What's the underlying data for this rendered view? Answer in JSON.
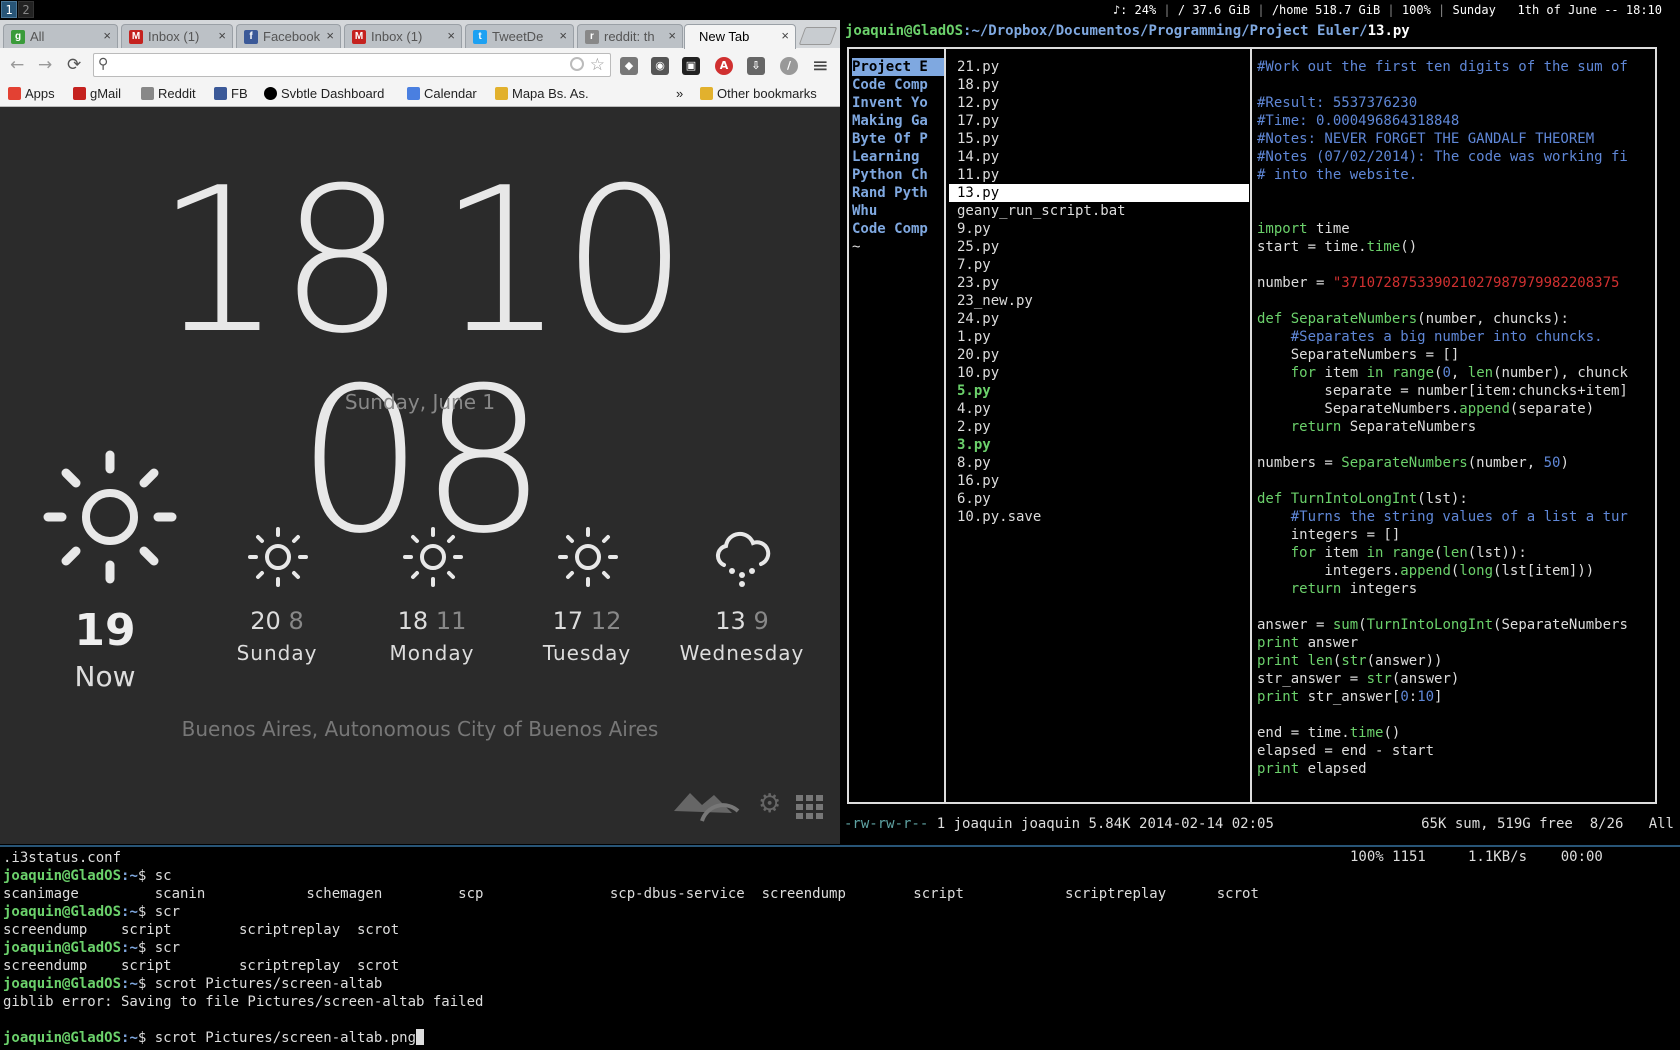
{
  "bar": {
    "workspaces": [
      "1",
      "2"
    ],
    "status": {
      "volume": "♪: 24%",
      "root": "/ 37.6 GiB",
      "home": "/home 518.7 GiB",
      "battery": "100%",
      "date": "Sunday   1th of June -- 18:10"
    }
  },
  "chrome": {
    "tabs": [
      {
        "label": "All",
        "close": "×",
        "color": "#3a9b3a",
        "icon": "g"
      },
      {
        "label": "Inbox (1)",
        "close": "×",
        "color": "#c5221f",
        "icon": "M"
      },
      {
        "label": "Facebook",
        "close": "×",
        "color": "#3b5998",
        "icon": "f"
      },
      {
        "label": "Inbox (1)",
        "close": "×",
        "color": "#c5221f",
        "icon": "M"
      },
      {
        "label": "TweetDe",
        "close": "×",
        "color": "#1da1f2",
        "icon": "t"
      },
      {
        "label": "reddit: th",
        "close": "×",
        "color": "#888888",
        "icon": "r"
      },
      {
        "label": "New Tab",
        "close": "×",
        "color": "",
        "icon": ""
      }
    ],
    "nav": {
      "back": "←",
      "forward": "→",
      "reload": "⟳"
    },
    "omnibox": {
      "value": "",
      "search_icon": "⚲"
    },
    "bookmarks": [
      {
        "label": "Apps",
        "color": "#e34133"
      },
      {
        "label": "gMail",
        "color": "#c5221f"
      },
      {
        "label": "Reddit",
        "color": "#888888"
      },
      {
        "label": "FB",
        "color": "#3b5998"
      },
      {
        "label": "Svbtle Dashboard",
        "color": "#000000"
      },
      {
        "label": "Calendar",
        "color": "#4a7fe0"
      },
      {
        "label": "Mapa Bs. As.",
        "color": "#e2b12d"
      }
    ],
    "bookmarks_overflow": "»",
    "other_bookmarks": "Other bookmarks",
    "menu": "≡"
  },
  "ntp": {
    "clock": {
      "h": "18",
      "m": "10",
      "s": "08"
    },
    "date": "Sunday, June 1",
    "now": {
      "temp": "19",
      "label": "Now"
    },
    "forecast": [
      {
        "hi": "20",
        "lo": "8",
        "day": "Sunday",
        "icon": "sun-icon"
      },
      {
        "hi": "18",
        "lo": "11",
        "day": "Monday",
        "icon": "sun-icon"
      },
      {
        "hi": "17",
        "lo": "12",
        "day": "Tuesday",
        "icon": "sun-icon"
      },
      {
        "hi": "13",
        "lo": "9",
        "day": "Wednesday",
        "icon": "rain-cloud-icon"
      }
    ],
    "location": "Buenos Aires, Autonomous City of Buenos Aires"
  },
  "ranger": {
    "title_user": "joaquin@GladOS",
    "title_path": ":~/Dropbox/Documentos/Programming/Project Euler/",
    "title_file": "13.py",
    "parent_items": [
      "Project E",
      "Code Comp",
      "Invent Yo",
      "Making Ga",
      "Byte Of P",
      "Learning ",
      "Python Ch",
      "Rand Pyth",
      "Whu",
      "Code Comp",
      "~"
    ],
    "files": [
      "21.py",
      "18.py",
      "12.py",
      "17.py",
      "15.py",
      "14.py",
      "11.py",
      "13.py",
      "geany_run_script.bat",
      "9.py",
      "25.py",
      "7.py",
      "23.py",
      "23_new.py",
      "24.py",
      "1.py",
      "20.py",
      "10.py",
      "5.py",
      "4.py",
      "2.py",
      "3.py",
      "8.py",
      "16.py",
      "6.py",
      "10.py.save"
    ],
    "selected_file": "13.py",
    "executable_files": [
      "5.py",
      "3.py"
    ],
    "code": [
      "#Work out the first ten digits of the sum of",
      "",
      "#Result: 5537376230",
      "#Time: 0.000496864318848",
      "#Notes: NEVER FORGET THE GANDALF THEOREM",
      "#Notes (07/02/2014): The code was working fi",
      "# into the website.",
      "",
      "",
      "import time",
      "start = time.time()",
      "",
      "number = \"371072875339021027987979982208375",
      "",
      "def SeparateNumbers(number, chuncks):",
      "    #Separates a big number into chuncks.",
      "    SeparateNumbers = []",
      "    for item in range(0, len(number), chunck",
      "        separate = number[item:chuncks+item]",
      "        SeparateNumbers.append(separate)",
      "    return SeparateNumbers",
      "",
      "numbers = SeparateNumbers(number, 50)",
      "",
      "def TurnIntoLongInt(lst):",
      "    #Turns the string values of a list a tur",
      "    integers = []",
      "    for item in range(len(lst)):",
      "        integers.append(long(lst[item]))",
      "    return integers",
      "",
      "answer = sum(TurnIntoLongInt(SeparateNumbers",
      "print answer",
      "print len(str(answer))",
      "str_answer = str(answer)",
      "print str_answer[0:10]",
      "",
      "end = time.time()",
      "elapsed = end - start",
      "print elapsed"
    ],
    "status_perm": "-rw-rw-r--",
    "status_info": " 1 joaquin joaquin 5.84K 2014-02-14 02:05",
    "status_right": "65K sum, 519G free  8/26   All"
  },
  "terminal": {
    "status": "100% 1151     1.1KB/s    00:00",
    "user": "joaquin@GladOS",
    "path": ":~",
    "lines": [
      {
        "type": "out",
        "text": ".i3status.conf"
      },
      {
        "type": "cmd",
        "text": "$ sc"
      },
      {
        "type": "out",
        "text": "scanimage         scanin            schemagen         scp               scp-dbus-service  screendump        script            scriptreplay      scrot"
      },
      {
        "type": "cmd",
        "text": "$ scr"
      },
      {
        "type": "out",
        "text": "screendump    script        scriptreplay  scrot"
      },
      {
        "type": "cmd",
        "text": "$ scr"
      },
      {
        "type": "out",
        "text": "screendump    script        scriptreplay  scrot"
      },
      {
        "type": "cmd",
        "text": "$ scrot Pictures/screen-altab"
      },
      {
        "type": "out",
        "text": "giblib error: Saving to file Pictures/screen-altab failed"
      },
      {
        "type": "out",
        "text": ""
      },
      {
        "type": "cmd",
        "text": "$ scrot Pictures/screen-altab.png"
      }
    ]
  }
}
